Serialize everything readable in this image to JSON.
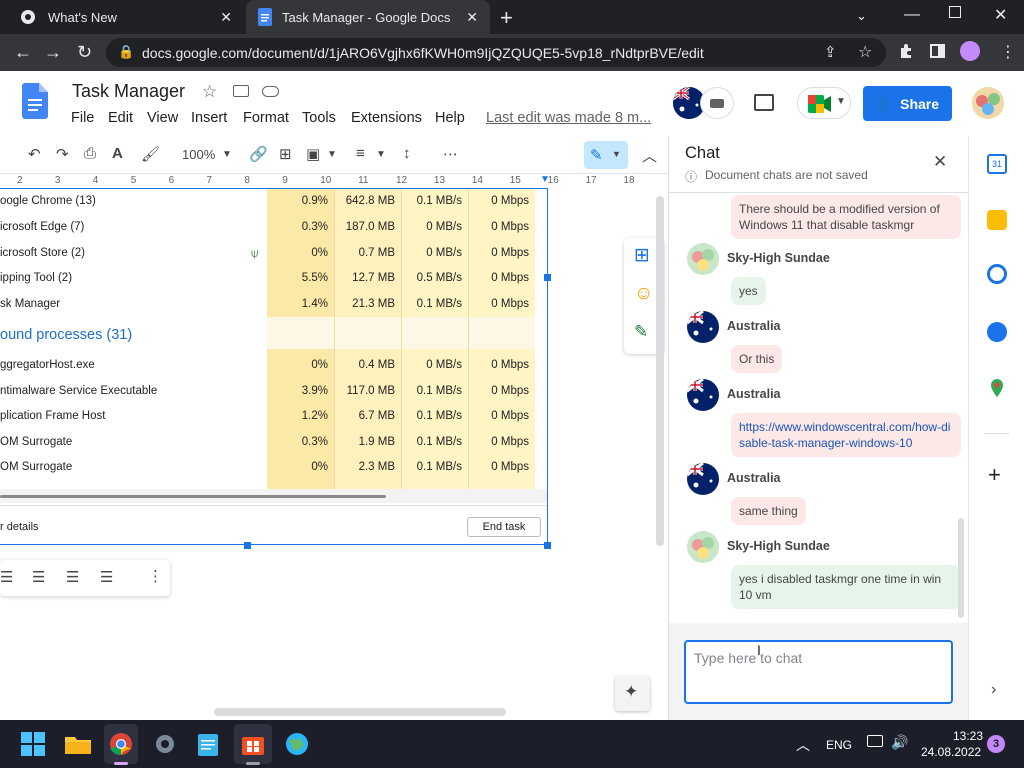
{
  "browser": {
    "tabs": [
      {
        "title": "What's New",
        "active": false
      },
      {
        "title": "Task Manager - Google Docs",
        "active": true
      }
    ],
    "url": "docs.google.com/document/d/1jARO6Vgjhx6fKWH0m9IjQZQUQE5-5vp18_rNdtprBVE/edit",
    "new_tab": "+"
  },
  "docs": {
    "title": "Task Manager",
    "menu": [
      "File",
      "Edit",
      "View",
      "Insert",
      "Format",
      "Tools",
      "Extensions",
      "Help"
    ],
    "last_edit": "Last edit was made 8 m...",
    "share_label": "Share",
    "zoom": "100%",
    "ruler_marks": [
      "2",
      "3",
      "4",
      "5",
      "6",
      "7",
      "8",
      "9",
      "10",
      "11",
      "12",
      "13",
      "14",
      "15",
      "16",
      "17",
      "18"
    ]
  },
  "taskmgr": {
    "rows": [
      {
        "name": "oogle Chrome (13)",
        "cpu": "0.9%",
        "mem": "642.8 MB",
        "disk": "0.1 MB/s",
        "net": "0 Mbps"
      },
      {
        "name": "icrosoft Edge (7)",
        "cpu": "0.3%",
        "mem": "187.0 MB",
        "disk": "0 MB/s",
        "net": "0 Mbps"
      },
      {
        "name": "icrosoft Store (2)",
        "cpu": "0%",
        "mem": "0.7 MB",
        "disk": "0 MB/s",
        "net": "0 Mbps"
      },
      {
        "name": "ipping Tool (2)",
        "cpu": "5.5%",
        "mem": "12.7 MB",
        "disk": "0.5 MB/s",
        "net": "0 Mbps"
      },
      {
        "name": "sk Manager",
        "cpu": "1.4%",
        "mem": "21.3 MB",
        "disk": "0.1 MB/s",
        "net": "0 Mbps"
      }
    ],
    "bg_heading": "ound processes (31)",
    "bg_rows": [
      {
        "name": "ggregatorHost.exe",
        "cpu": "0%",
        "mem": "0.4 MB",
        "disk": "0 MB/s",
        "net": "0 Mbps"
      },
      {
        "name": "ntimalware Service Executable",
        "cpu": "3.9%",
        "mem": "117.0 MB",
        "disk": "0.1 MB/s",
        "net": "0 Mbps"
      },
      {
        "name": "plication Frame Host",
        "cpu": "1.2%",
        "mem": "6.7 MB",
        "disk": "0.1 MB/s",
        "net": "0 Mbps"
      },
      {
        "name": "OM Surrogate",
        "cpu": "0.3%",
        "mem": "1.9 MB",
        "disk": "0.1 MB/s",
        "net": "0 Mbps"
      },
      {
        "name": "OM Surrogate",
        "cpu": "0%",
        "mem": "2.3 MB",
        "disk": "0.1 MB/s",
        "net": "0 Mbps"
      }
    ],
    "details_label": "r details",
    "end_task_label": "End task"
  },
  "chat": {
    "title": "Chat",
    "note": "Document chats are not saved",
    "messages": [
      {
        "sender": "",
        "text": "There should be a modified version of Windows 11 that disable taskmgr",
        "style": "red"
      },
      {
        "sender": "Sky-High Sundae",
        "text": "yes",
        "style": "green"
      },
      {
        "sender": "Australia",
        "text": "Or this",
        "style": "red"
      },
      {
        "sender": "Australia",
        "text": "https://www.windowscentral.com/how-disable-task-manager-windows-10",
        "style": "red"
      },
      {
        "sender": "Australia",
        "text": "same thing",
        "style": "red"
      },
      {
        "sender": "Sky-High Sundae",
        "text": "yes i disabled taskmgr one time in win 10 vm",
        "style": "green"
      }
    ],
    "input_placeholder": "Type here to chat"
  },
  "taskbar": {
    "lang": "ENG",
    "time": "13:23",
    "date": "24.08.2022",
    "notif_count": "3"
  },
  "colors": {
    "docs_blue": "#1a73e8",
    "tm_highlight": "#fff4c4",
    "tm_highlight_dark": "#f9eba0",
    "chat_green": "#e6f4ea",
    "chat_red": "#fce8e6"
  }
}
